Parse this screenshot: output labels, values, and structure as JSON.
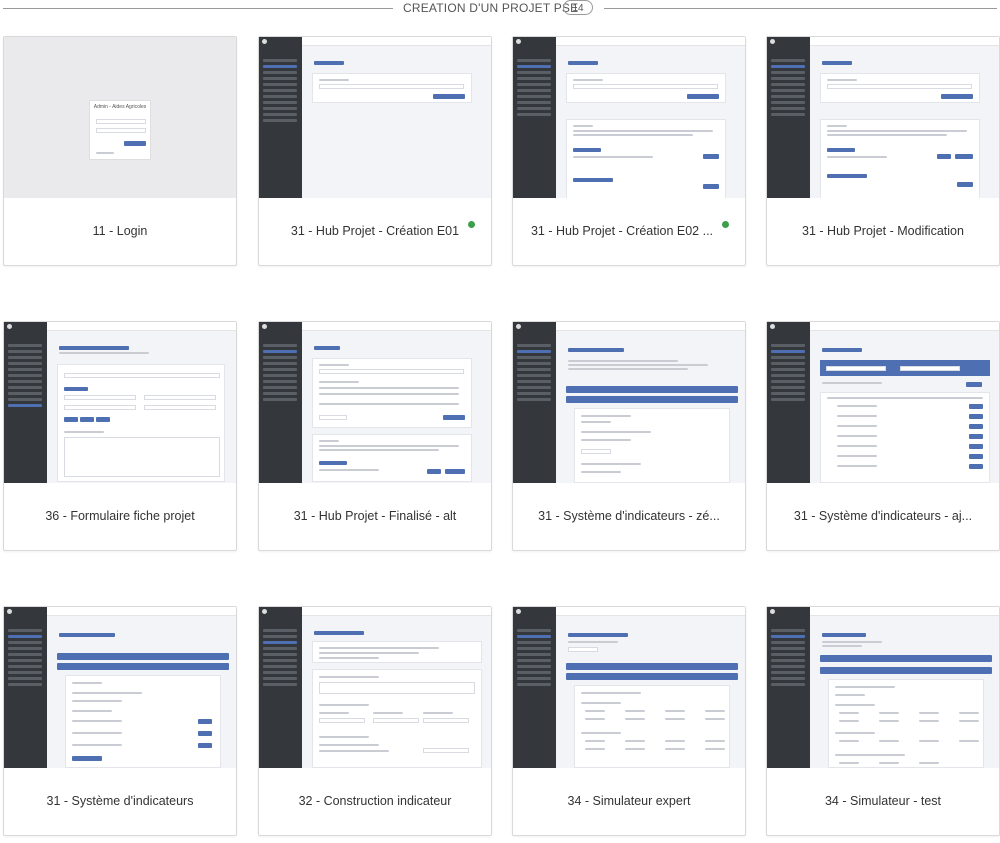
{
  "header": {
    "title": "CREATION D'UN PROJET PSE",
    "count": "14"
  },
  "colors": {
    "accent": "#4f6fb3",
    "status_green": "#3ca04a",
    "sidebar": "#34383d"
  },
  "cards": [
    {
      "label": "11 - Login",
      "status": false
    },
    {
      "label": "31 - Hub Projet - Création E01",
      "status": true
    },
    {
      "label": "31 - Hub Projet - Création E02 ...",
      "status": true
    },
    {
      "label": "31 - Hub Projet - Modification",
      "status": false
    },
    {
      "label": "36 - Formulaire fiche projet",
      "status": false
    },
    {
      "label": "31 - Hub Projet - Finalisé - alt",
      "status": false
    },
    {
      "label": "31 - Système d'indicateurs - zé...",
      "status": false
    },
    {
      "label": "31 - Système d'indicateurs - aj...",
      "status": false
    },
    {
      "label": "31 - Système d'indicateurs",
      "status": false
    },
    {
      "label": "32 - Construction indicateur",
      "status": false
    },
    {
      "label": "34 - Simulateur expert",
      "status": false
    },
    {
      "label": "34 - Simulateur - test",
      "status": false
    }
  ],
  "login_thumb": {
    "title": "Admin - Aides Agricoles"
  }
}
